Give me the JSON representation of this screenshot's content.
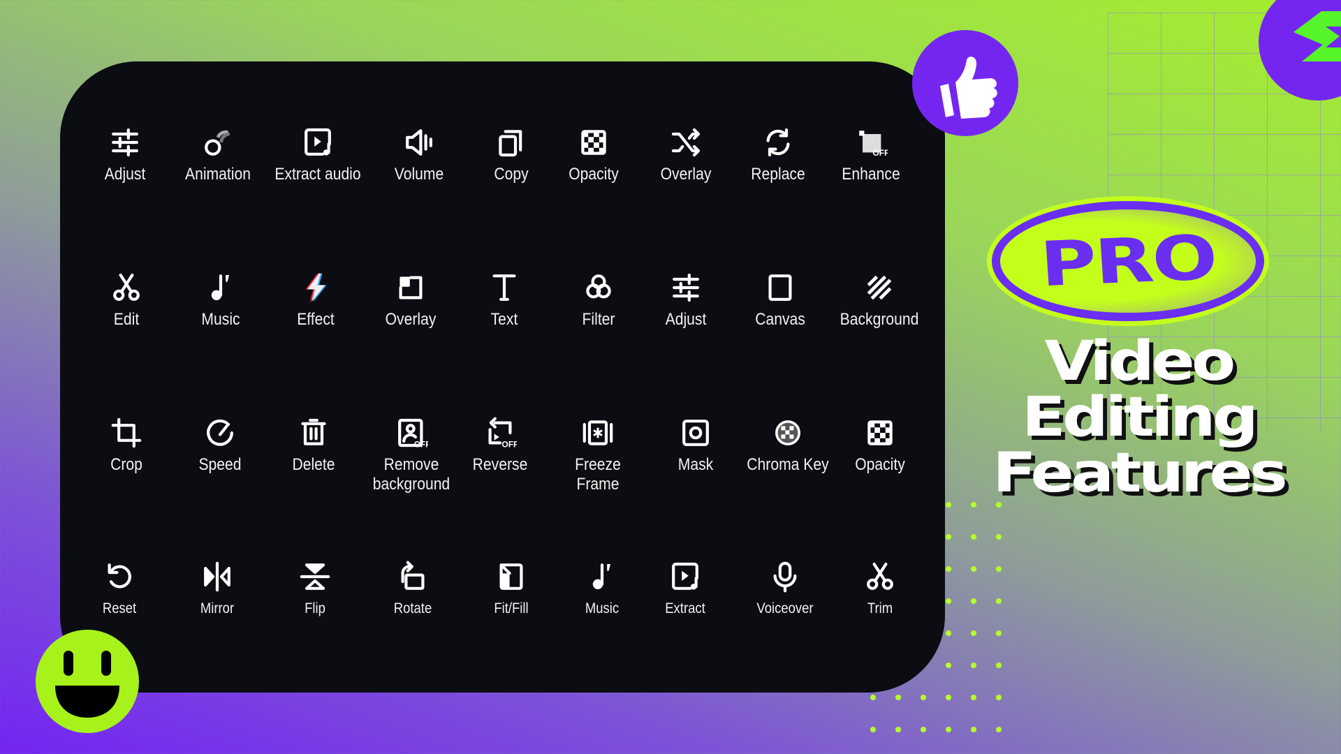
{
  "tool_rows": [
    [
      {
        "label": "Adjust",
        "icon": "sliders-icon"
      },
      {
        "label": "Animation",
        "icon": "animation-icon"
      },
      {
        "label": "Extract audio",
        "icon": "extract-audio-icon"
      },
      {
        "label": "Volume",
        "icon": "volume-icon"
      },
      {
        "label": "Copy",
        "icon": "copy-icon"
      },
      {
        "label": "Opacity",
        "icon": "checker-icon"
      },
      {
        "label": "Overlay",
        "icon": "shuffle-icon"
      },
      {
        "label": "Replace",
        "icon": "replace-icon"
      },
      {
        "label": "Enhance",
        "icon": "enhance-icon"
      }
    ],
    [
      {
        "label": "Edit",
        "icon": "scissors-icon"
      },
      {
        "label": "Music",
        "icon": "music-note-icon"
      },
      {
        "label": "Effect",
        "icon": "lightning-icon"
      },
      {
        "label": "Overlay",
        "icon": "overlay-icon"
      },
      {
        "label": "Text",
        "icon": "text-icon"
      },
      {
        "label": "Filter",
        "icon": "filter-icon"
      },
      {
        "label": "Adjust",
        "icon": "sliders-icon"
      },
      {
        "label": "Canvas",
        "icon": "canvas-icon"
      },
      {
        "label": "Background",
        "icon": "stripes-icon"
      }
    ],
    [
      {
        "label": "Crop",
        "icon": "crop-icon"
      },
      {
        "label": "Speed",
        "icon": "speed-icon"
      },
      {
        "label": "Delete",
        "icon": "trash-icon"
      },
      {
        "label": "Remove\nbackground",
        "icon": "remove-bg-icon"
      },
      {
        "label": "Reverse",
        "icon": "reverse-icon"
      },
      {
        "label": "Freeze Frame",
        "icon": "freeze-frame-icon"
      },
      {
        "label": "Mask",
        "icon": "mask-icon"
      },
      {
        "label": "Chroma Key",
        "icon": "chroma-key-icon"
      },
      {
        "label": "Opacity",
        "icon": "checker-icon"
      }
    ],
    [
      {
        "label": "Reset",
        "icon": "reset-icon"
      },
      {
        "label": "Mirror",
        "icon": "mirror-icon"
      },
      {
        "label": "Flip",
        "icon": "flip-icon"
      },
      {
        "label": "Rotate",
        "icon": "rotate-icon"
      },
      {
        "label": "Fit/Fill",
        "icon": "fit-fill-icon"
      },
      {
        "label": "Music",
        "icon": "music-note-icon"
      },
      {
        "label": "Extract",
        "icon": "extract-audio-icon"
      },
      {
        "label": "Voiceover",
        "icon": "microphone-icon"
      },
      {
        "label": "Trim",
        "icon": "scissors-icon"
      }
    ]
  ],
  "badge": {
    "label": "PRO"
  },
  "title": {
    "line1": "Video",
    "line2": "Editing",
    "line3": "Features"
  },
  "colors": {
    "purple": "#7426f0",
    "lime": "#b4ff2a",
    "panel": "#0b0d12"
  }
}
